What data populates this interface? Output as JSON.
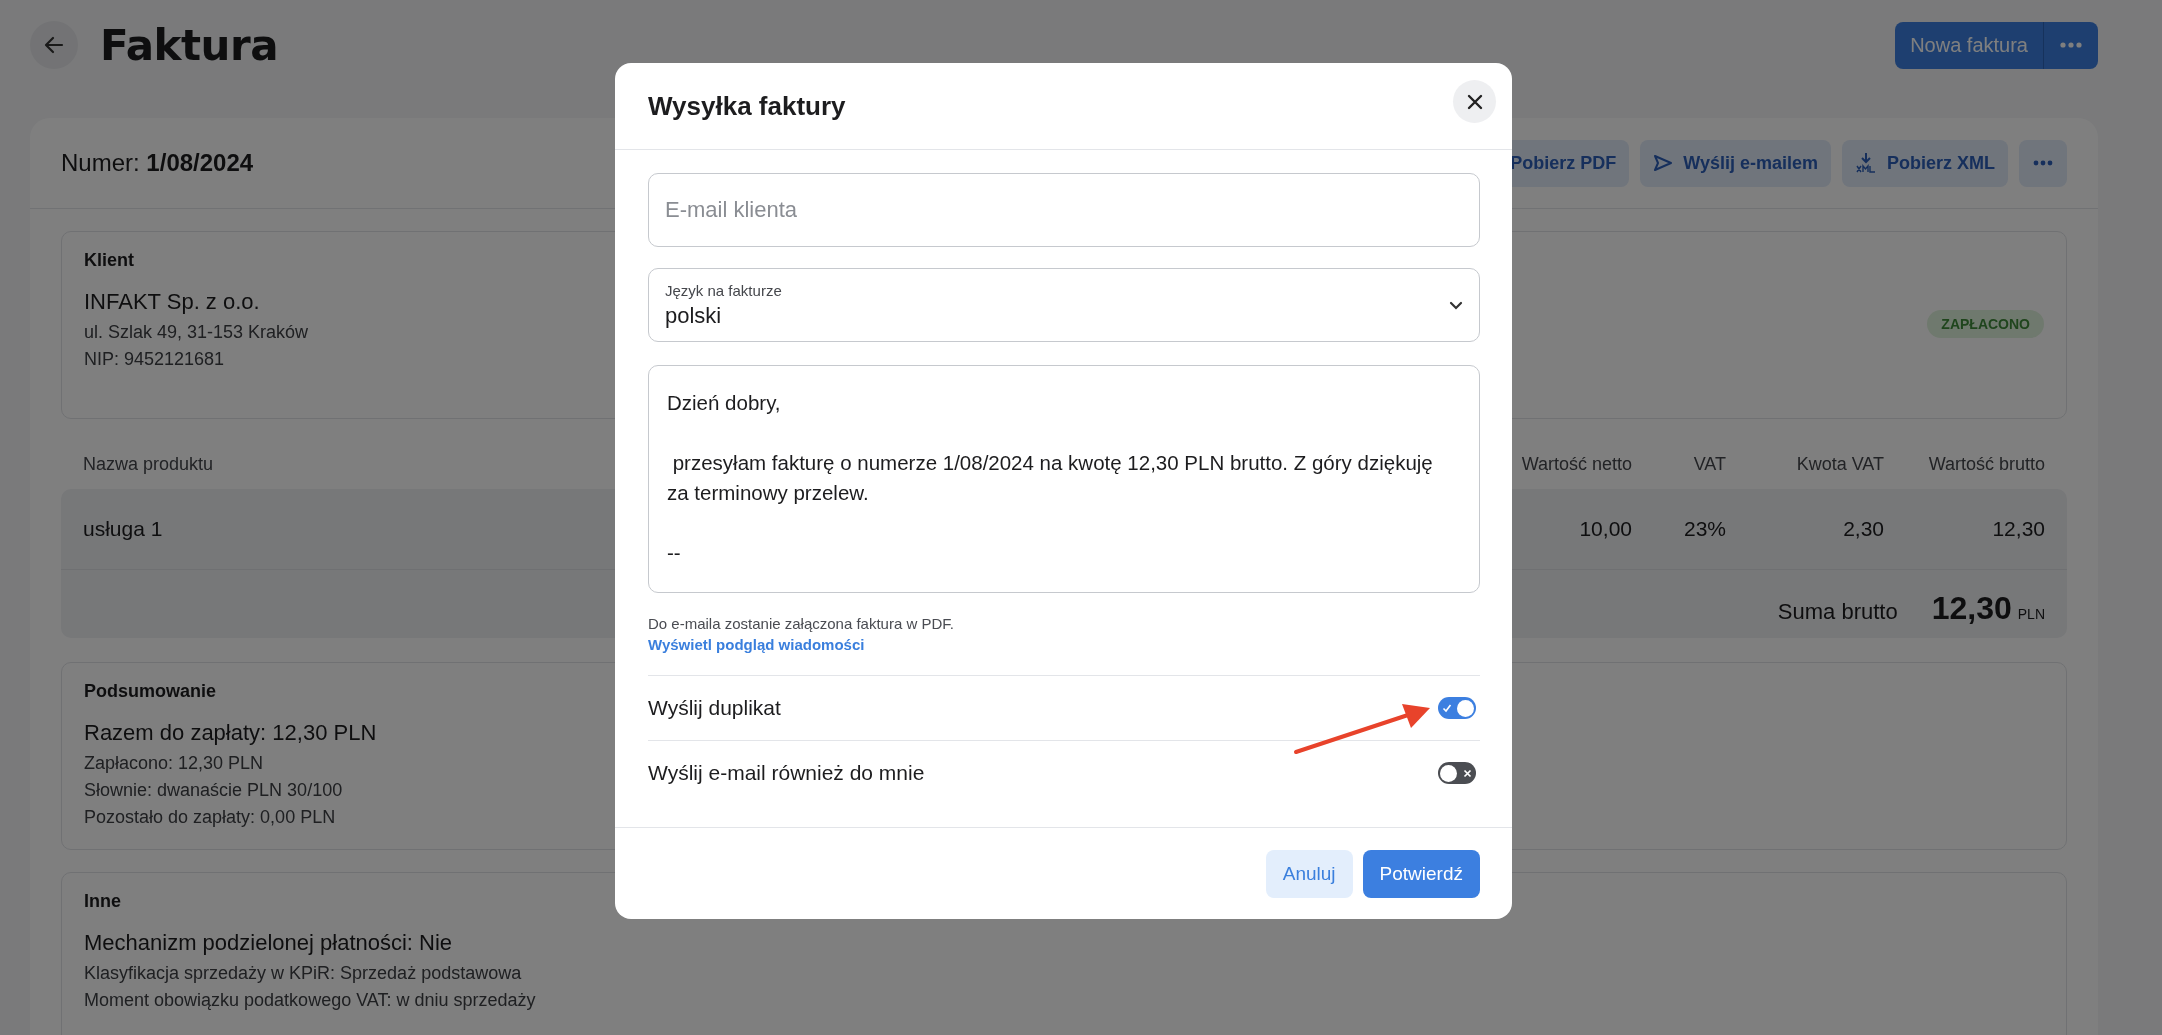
{
  "header": {
    "title": "Faktura",
    "new_invoice_button": "Nowa faktura"
  },
  "invoice": {
    "number_label": "Numer:",
    "number": "1/08/2024",
    "actions": [
      {
        "label": "Pobierz PDF",
        "kind": "plain"
      },
      {
        "label": "Wyślij e-mailem",
        "kind": "send"
      },
      {
        "label": "Pobierz XML",
        "kind": "xml"
      },
      {
        "kind": "more"
      }
    ]
  },
  "client": {
    "heading": "Klient",
    "name": "INFAKT Sp. z o.o.",
    "address": "ul. Szlak 49, 31-153 Kraków",
    "nip": "NIP: 9452121681",
    "status": "ZAPŁACONO"
  },
  "items_table": {
    "columns": [
      {
        "label": "Nazwa produktu"
      },
      {
        "label": "Wartość netto"
      },
      {
        "label": "VAT"
      },
      {
        "label": "Kwota VAT"
      },
      {
        "label": "Wartość brutto"
      }
    ],
    "rows": [
      {
        "cells": [
          "usługa 1",
          "10,00",
          "23%",
          "2,30",
          "12,30"
        ]
      }
    ],
    "total": {
      "label": "Suma brutto",
      "amount": "12,30",
      "currency": "PLN"
    }
  },
  "summary": {
    "heading": "Podsumowanie",
    "main_line": "Razem do zapłaty: 12,30 PLN",
    "lines": [
      "Zapłacono: 12,30 PLN",
      "Słownie: dwanaście PLN 30/100",
      "Pozostało do zapłaty: 0,00 PLN"
    ]
  },
  "other": {
    "heading": "Inne",
    "main_line": "Mechanizm podzielonej płatności: Nie",
    "lines": [
      "Klasyfikacja sprzedaży w KPiR: Sprzedaż podstawowa",
      "Moment obowiązku podatkowego VAT: w dniu sprzedaży"
    ]
  },
  "dialog": {
    "title": "Wysyłka faktury",
    "email_field": {
      "placeholder": "E-mail klienta"
    },
    "language_select": {
      "label": "Język na fakturze",
      "value": "polski"
    },
    "message": "Dzień dobry,\n\n przesyłam fakturę o numerze 1/08/2024 na kwotę 12,30 PLN brutto. Z góry dziękuję za terminowy przelew.\n\n--",
    "note": "Do e-maila zostanie załączona faktura w PDF.",
    "preview_link": "Wyświetl podgląd wiadomości",
    "toggles": [
      {
        "label": "Wyślij duplikat",
        "on": true
      },
      {
        "label": "Wyślij e-mail również do mnie",
        "on": false
      }
    ],
    "buttons": [
      {
        "label": "Anuluj",
        "kind": "secondary"
      },
      {
        "label": "Potwierdź",
        "kind": "primary"
      }
    ]
  }
}
